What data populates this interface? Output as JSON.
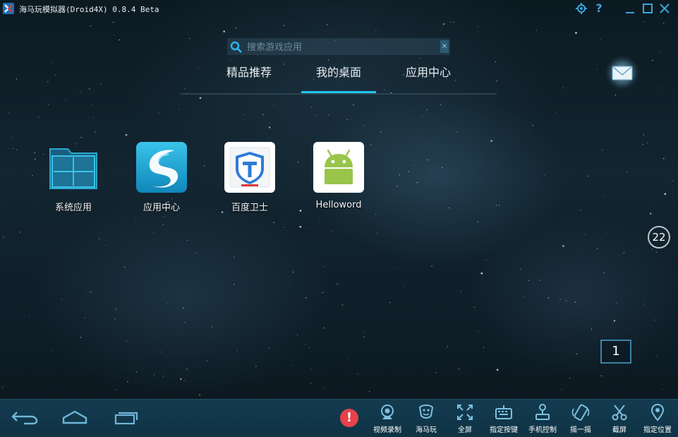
{
  "window": {
    "title": "海马玩模拟器(Droid4X) 0.8.4 Beta"
  },
  "search": {
    "placeholder": "搜索游戏应用",
    "clear_label": "×"
  },
  "tabs": [
    {
      "label": "精品推荐",
      "active": false
    },
    {
      "label": "我的桌面",
      "active": true
    },
    {
      "label": "应用中心",
      "active": false
    }
  ],
  "desktop": {
    "apps": [
      {
        "label": "系统应用",
        "icon": "folder-icon"
      },
      {
        "label": "应用中心",
        "icon": "app-center-icon"
      },
      {
        "label": "百度卫士",
        "icon": "baidu-guard-icon"
      },
      {
        "label": "Helloword",
        "icon": "android-icon"
      }
    ],
    "boost_value": "22",
    "page_number": "1"
  },
  "bottom_bar": {
    "alert_symbol": "!",
    "tools": [
      {
        "label": "视频录制",
        "icon": "camera-icon"
      },
      {
        "label": "海马玩",
        "icon": "haimawan-icon"
      },
      {
        "label": "全屏",
        "icon": "fullscreen-icon"
      },
      {
        "label": "指定按键",
        "icon": "keyboard-icon"
      },
      {
        "label": "手机控制",
        "icon": "joystick-icon"
      },
      {
        "label": "摇一摇",
        "icon": "shake-icon"
      },
      {
        "label": "截屏",
        "icon": "scissors-icon"
      },
      {
        "label": "指定位置",
        "icon": "location-pin-icon"
      }
    ]
  },
  "colors": {
    "accent": "#21c6ee",
    "titlebar_icons": "#3aa7d8",
    "bottom_bar": "#143b4f",
    "alert": "#e6424a"
  }
}
